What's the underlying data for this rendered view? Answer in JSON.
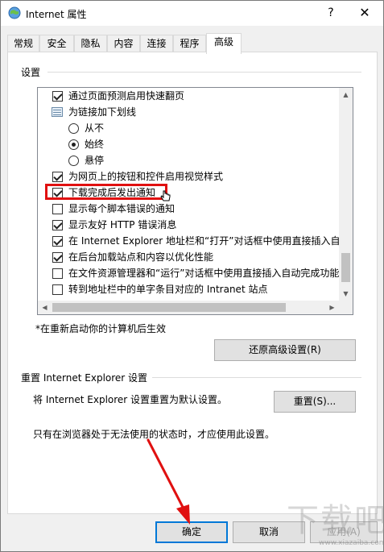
{
  "window": {
    "title": "Internet 属性",
    "help_glyph": "?",
    "close_glyph": "✕"
  },
  "tabs": [
    {
      "label": "常规"
    },
    {
      "label": "安全"
    },
    {
      "label": "隐私"
    },
    {
      "label": "内容"
    },
    {
      "label": "连接"
    },
    {
      "label": "程序"
    },
    {
      "label": "高级"
    }
  ],
  "active_tab": "高级",
  "settings": {
    "section_label": "设置",
    "items": [
      {
        "type": "checkbox",
        "checked": true,
        "label": "通过页面预测启用快速翻页"
      },
      {
        "type": "folder",
        "label": "为链接加下划线"
      },
      {
        "type": "radio",
        "checked": false,
        "label": "从不"
      },
      {
        "type": "radio",
        "checked": true,
        "label": "始终"
      },
      {
        "type": "radio",
        "checked": false,
        "label": "悬停"
      },
      {
        "type": "checkbox",
        "checked": true,
        "label": "为网页上的按钮和控件启用视觉样式"
      },
      {
        "type": "checkbox",
        "checked": true,
        "label": "下载完成后发出通知"
      },
      {
        "type": "checkbox",
        "checked": false,
        "label": "显示每个脚本错误的通知"
      },
      {
        "type": "checkbox",
        "checked": true,
        "label": "显示友好 HTTP 错误消息"
      },
      {
        "type": "checkbox",
        "checked": true,
        "label": "在 Internet Explorer 地址栏和“打开”对话框中使用直接插入自"
      },
      {
        "type": "checkbox",
        "checked": true,
        "label": "在后台加载站点和内容以优化性能"
      },
      {
        "type": "checkbox",
        "checked": false,
        "label": "在文件资源管理器和“运行”对话框中使用直接插入自动完成功能"
      },
      {
        "type": "checkbox",
        "checked": false,
        "label": "转到地址栏中的单字条目对应的 Intranet 站点"
      }
    ],
    "restart_note": "*在重新启动你的计算机后生效",
    "restore_button": "还原高级设置(R)"
  },
  "reset": {
    "section_label": "重置 Internet Explorer 设置",
    "description": "将 Internet Explorer 设置重置为默认设置。",
    "reset_button": "重置(S)...",
    "note": "只有在浏览器处于无法使用的状态时，才应使用此设置。"
  },
  "footer": {
    "ok_button": "确定",
    "cancel_button": "取消",
    "apply_button": "应用(A)"
  },
  "colors": {
    "highlight": "#e01010",
    "arrow": "#e01010"
  },
  "watermark": {
    "text": "下载吧",
    "url": "www.xiazaiba.com"
  }
}
